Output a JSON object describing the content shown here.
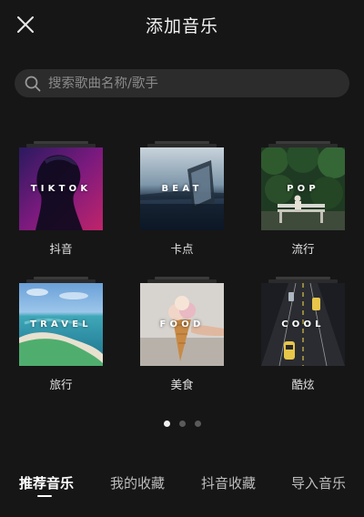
{
  "header": {
    "title": "添加音乐",
    "close_icon": "close-icon"
  },
  "search": {
    "placeholder": "搜索歌曲名称/歌手",
    "icon": "search-icon"
  },
  "categories": [
    {
      "cover_text": "TIKTOK",
      "label": "抖音"
    },
    {
      "cover_text": "BEAT",
      "label": "卡点"
    },
    {
      "cover_text": "POP",
      "label": "流行"
    },
    {
      "cover_text": "TRAVEL",
      "label": "旅行"
    },
    {
      "cover_text": "FOOD",
      "label": "美食"
    },
    {
      "cover_text": "COOL",
      "label": "酷炫"
    }
  ],
  "pager": {
    "pages": 3,
    "active": 1
  },
  "tabs": [
    {
      "label": "推荐音乐",
      "active": true
    },
    {
      "label": "我的收藏",
      "active": false
    },
    {
      "label": "抖音收藏",
      "active": false
    },
    {
      "label": "导入音乐",
      "active": false
    }
  ],
  "colors": {
    "background": "#161616",
    "search_bg": "#2c2c2c",
    "text": "#ffffff",
    "muted": "#bdbdbd"
  }
}
